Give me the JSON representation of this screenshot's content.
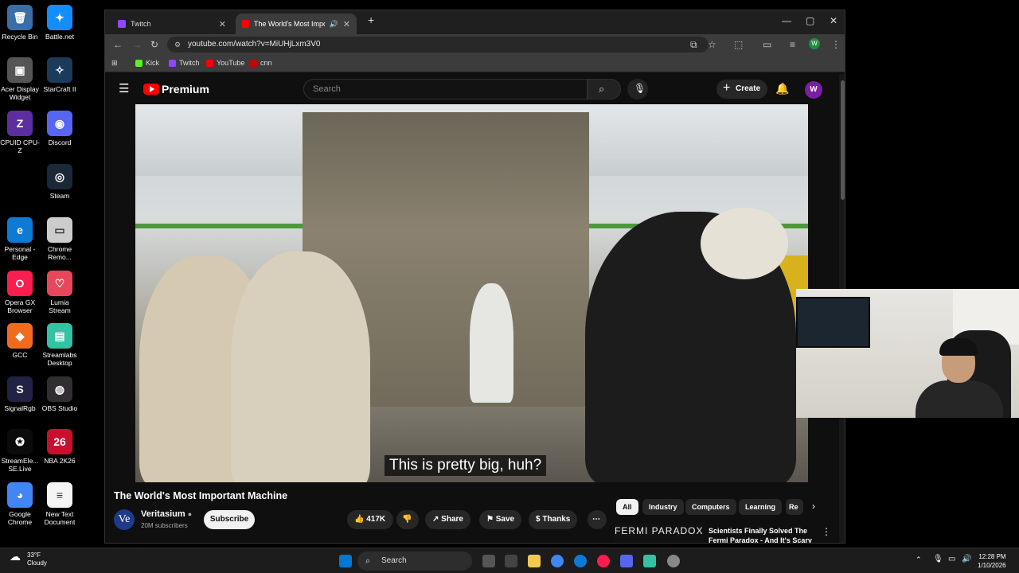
{
  "desktop": {
    "icons": [
      {
        "label": "Recycle Bin",
        "glyph": "🗑",
        "color": "#3a6ea5"
      },
      {
        "label": "Battle.net",
        "glyph": "✦",
        "color": "#148eff"
      },
      {
        "label": "Acer Display Widget",
        "glyph": "▣",
        "color": "#555555"
      },
      {
        "label": "StarCraft II",
        "glyph": "✧",
        "color": "#1c3a5a"
      },
      {
        "label": "CPUID CPU-Z",
        "glyph": "Z",
        "color": "#5b2fa0"
      },
      {
        "label": "Discord",
        "glyph": "◉",
        "color": "#5865f2"
      },
      {
        "label": "Steam",
        "glyph": "◎",
        "color": "#1b2838"
      },
      {
        "label": "Personal - Edge",
        "glyph": "e",
        "color": "#0c7bd6"
      },
      {
        "label": "Chrome Remo...",
        "glyph": "▭",
        "color": "#cccccc"
      },
      {
        "label": "Opera GX Browser",
        "glyph": "O",
        "color": "#fa1e4e"
      },
      {
        "label": "Lumia Stream",
        "glyph": "♡",
        "color": "#e8465b"
      },
      {
        "label": "GCC",
        "glyph": "◆",
        "color": "#f26b1d"
      },
      {
        "label": "Streamlabs Desktop",
        "glyph": "▤",
        "color": "#31c3a2"
      },
      {
        "label": "SignalRgb",
        "glyph": "S",
        "color": "#222244"
      },
      {
        "label": "OBS Studio",
        "glyph": "◍",
        "color": "#302e31"
      },
      {
        "label": "StreamEle... SE.Live",
        "glyph": "✪",
        "color": "#0b0b0b"
      },
      {
        "label": "NBA 2K26",
        "glyph": "26",
        "color": "#c8102e"
      },
      {
        "label": "Google Chrome",
        "glyph": "◕",
        "color": "#4285f4"
      },
      {
        "label": "New Text Document",
        "glyph": "≡",
        "color": "#f5f5f5"
      }
    ]
  },
  "browser": {
    "tabs": [
      {
        "label": "Twitch",
        "color": "#9146ff"
      },
      {
        "label": "The World's Most Importan",
        "color": "#ff0000"
      }
    ],
    "url": "youtube.com/watch?v=MiUHjLxm3V0",
    "bookmarks": [
      {
        "label": "Kick",
        "color": "#53fc18"
      },
      {
        "label": "Twitch",
        "color": "#9146ff"
      },
      {
        "label": "YouTube",
        "color": "#ff0000"
      },
      {
        "label": "cnn",
        "color": "#cc0000"
      }
    ],
    "profile_initial": "W"
  },
  "youtube": {
    "brand": "Premium",
    "search_placeholder": "Search",
    "create_label": "Create",
    "avatar_initial": "W",
    "subtitle": "This is pretty big, huh?",
    "watermark": "Ve",
    "video_title": "The World's Most Important Machine",
    "channel_initials": "Ve",
    "channel_name": "Veritasium",
    "channel_subs": "20M subscribers",
    "subscribe_label": "Subscribe",
    "likes": "417K",
    "share_label": "Share",
    "save_label": "Save",
    "thanks_label": "Thanks",
    "chips": [
      "All",
      "Industry",
      "Computers",
      "Learning",
      "Re"
    ],
    "rec_thumb_text": "FERMI PARADOX",
    "rec_title": "Scientists Finally Solved The Fermi Paradox - And It's Scary"
  },
  "taskbar": {
    "temperature": "33°F",
    "condition": "Cloudy",
    "search_label": "Search",
    "time": "12:28 PM",
    "date": "1/10/2026"
  }
}
